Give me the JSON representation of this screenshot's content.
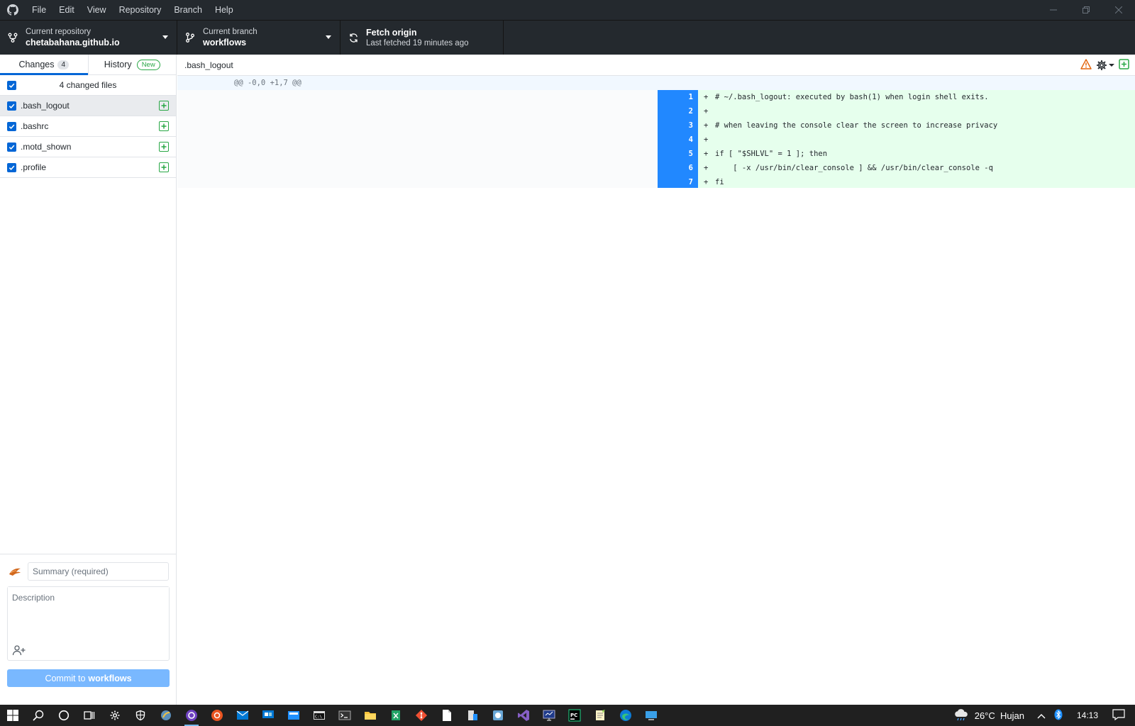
{
  "menu": [
    "File",
    "Edit",
    "View",
    "Repository",
    "Branch",
    "Help"
  ],
  "toolbar": {
    "repo_label": "Current repository",
    "repo_value": "chetabahana.github.io",
    "branch_label": "Current branch",
    "branch_value": "workflows",
    "fetch_title": "Fetch origin",
    "fetch_sub": "Last fetched 19 minutes ago"
  },
  "tabs": {
    "changes_label": "Changes",
    "changes_count": "4",
    "history_label": "History",
    "history_badge": "New"
  },
  "files": {
    "header": "4 changed files",
    "items": [
      ".bash_logout",
      ".bashrc",
      ".motd_shown",
      ".profile"
    ]
  },
  "commit": {
    "summary_placeholder": "Summary (required)",
    "description_placeholder": "Description",
    "button_prefix": "Commit to",
    "button_branch": "workflows"
  },
  "diff": {
    "file": ".bash_logout",
    "hunk": "@@ -0,0 +1,7 @@",
    "line_numbers": [
      "1",
      "2",
      "3",
      "4",
      "5",
      "6",
      "7"
    ],
    "lines": [
      "# ~/.bash_logout: executed by bash(1) when login shell exits.",
      "",
      "# when leaving the console clear the screen to increase privacy",
      "",
      "if [ \"$SHLVL\" = 1 ]; then",
      "    [ -x /usr/bin/clear_console ] && /usr/bin/clear_console -q",
      "fi"
    ],
    "plus": "+"
  },
  "taskbar": {
    "weather": "26°C  Hujan",
    "time": "14:13"
  },
  "colors": {
    "accent": "#0366d6",
    "added_bg": "#e6ffed",
    "gutter": "#2188ff",
    "commit_button": "#79b8ff"
  }
}
